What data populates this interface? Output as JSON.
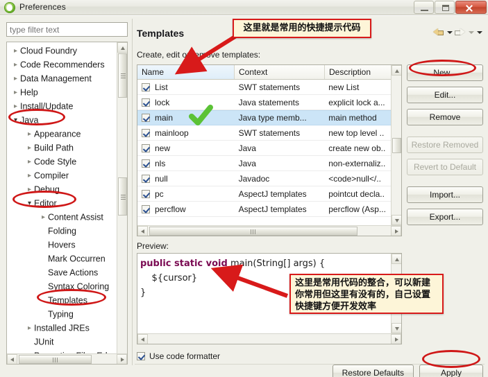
{
  "window": {
    "title": "Preferences",
    "icon": "eclipse-icon",
    "minimize_label": "",
    "maximize_label": "",
    "close_label": ""
  },
  "sidebar": {
    "filter": {
      "placeholder": "type filter text",
      "value": ""
    },
    "items": [
      {
        "label": "Cloud Foundry",
        "level": 1,
        "state": "collapsed"
      },
      {
        "label": "Code Recommenders",
        "level": 1,
        "state": "collapsed"
      },
      {
        "label": "Data Management",
        "level": 1,
        "state": "collapsed"
      },
      {
        "label": "Help",
        "level": 1,
        "state": "collapsed"
      },
      {
        "label": "Install/Update",
        "level": 1,
        "state": "collapsed"
      },
      {
        "label": "Java",
        "level": 1,
        "state": "expanded"
      },
      {
        "label": "Appearance",
        "level": 2,
        "state": "collapsed"
      },
      {
        "label": "Build Path",
        "level": 2,
        "state": "collapsed"
      },
      {
        "label": "Code Style",
        "level": 2,
        "state": "collapsed"
      },
      {
        "label": "Compiler",
        "level": 2,
        "state": "collapsed"
      },
      {
        "label": "Debug",
        "level": 2,
        "state": "collapsed"
      },
      {
        "label": "Editor",
        "level": 2,
        "state": "expanded"
      },
      {
        "label": "Content Assist",
        "level": 3,
        "state": "collapsed"
      },
      {
        "label": "Folding",
        "level": 3,
        "state": "none"
      },
      {
        "label": "Hovers",
        "level": 3,
        "state": "none"
      },
      {
        "label": "Mark Occurren",
        "level": 3,
        "state": "none"
      },
      {
        "label": "Save Actions",
        "level": 3,
        "state": "none"
      },
      {
        "label": "Syntax Coloring",
        "level": 3,
        "state": "none"
      },
      {
        "label": "Templates",
        "level": 3,
        "state": "none"
      },
      {
        "label": "Typing",
        "level": 3,
        "state": "none"
      },
      {
        "label": "Installed JREs",
        "level": 2,
        "state": "collapsed"
      },
      {
        "label": "JUnit",
        "level": 2,
        "state": "none"
      },
      {
        "label": "Properties Files Ed",
        "level": 2,
        "state": "none"
      }
    ]
  },
  "page": {
    "title": "Templates",
    "subtitle": "Create, edit or remove templates:",
    "nav": {
      "back_icon": "back-arrow-icon",
      "back_menu_icon": "chevron-down-icon",
      "forward_icon": "forward-arrow-icon",
      "forward_menu_icon": "chevron-down-icon",
      "view_menu_icon": "chevron-down-icon"
    }
  },
  "table": {
    "columns": [
      "Name",
      "Context",
      "Description"
    ],
    "rows": [
      {
        "checked": true,
        "name": "List",
        "context": "SWT statements",
        "description": "new List",
        "selected": false
      },
      {
        "checked": true,
        "name": "lock",
        "context": "Java statements",
        "description": "explicit lock a...",
        "selected": false
      },
      {
        "checked": true,
        "name": "main",
        "context": "Java type memb...",
        "description": "main method",
        "selected": true
      },
      {
        "checked": true,
        "name": "mainloop",
        "context": "SWT statements",
        "description": "new top level ..",
        "selected": false
      },
      {
        "checked": true,
        "name": "new",
        "context": "Java",
        "description": "create new ob..",
        "selected": false
      },
      {
        "checked": true,
        "name": "nls",
        "context": "Java",
        "description": "non-externaliz..",
        "selected": false
      },
      {
        "checked": true,
        "name": "null",
        "context": "Javadoc",
        "description": "<code>null</..",
        "selected": false
      },
      {
        "checked": true,
        "name": "pc",
        "context": "AspectJ templates",
        "description": "pointcut decla..",
        "selected": false
      },
      {
        "checked": true,
        "name": "percflow",
        "context": "AspectJ templates",
        "description": "percflow (Asp...",
        "selected": false
      }
    ]
  },
  "buttons": {
    "new": "New...",
    "edit": "Edit...",
    "remove": "Remove",
    "restore_removed": "Restore Removed",
    "revert_to_default": "Revert to Default",
    "import": "Import...",
    "export": "Export...",
    "restore_defaults": "Restore Defaults",
    "apply": "Apply"
  },
  "preview": {
    "label": "Preview:",
    "line1_keyword": "public static void",
    "line1_rest": " main(String[] args) {",
    "line2": "    ${cursor}",
    "line3": "}"
  },
  "footer": {
    "use_code_formatter": "Use code formatter",
    "use_code_formatter_checked": true
  },
  "annotations": {
    "callout_top": "这里就是常用的快捷提示代码",
    "callout_preview_line1": "这里是常用代码的整合，可以新建",
    "callout_preview_line2": "你常用但这里有没有的，自己设置",
    "callout_preview_line3": "快捷键方便开发效率",
    "highlight_color": "#cf1717",
    "callout_bg": "#fdf5d8",
    "check_mark_color": "#5bc236",
    "ellipses": [
      "java-tree-item",
      "editor-tree-item",
      "templates-tree-item",
      "new-button",
      "apply-button"
    ]
  }
}
